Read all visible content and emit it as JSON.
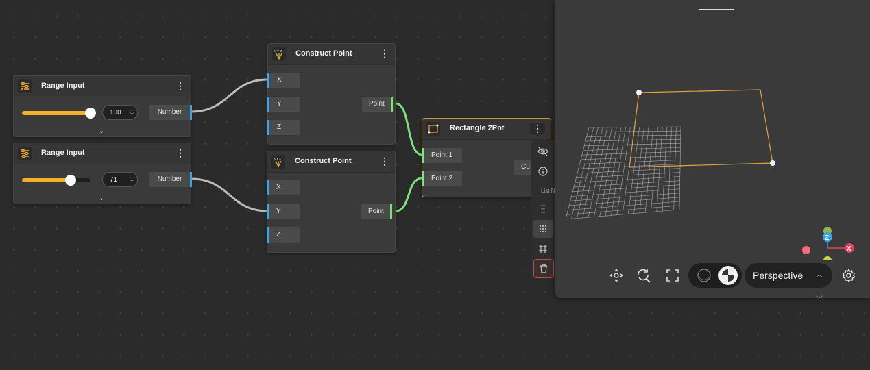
{
  "nodes": {
    "range1": {
      "title": "Range Input",
      "value": "100",
      "output": "Number",
      "slider_fraction": 1.0
    },
    "range2": {
      "title": "Range Input",
      "value": "71",
      "output": "Number",
      "slider_fraction": 0.71
    },
    "construct1": {
      "title": "Construct Point",
      "inputs": [
        "X",
        "Y",
        "Z"
      ],
      "output": "Point"
    },
    "construct2": {
      "title": "Construct Point",
      "inputs": [
        "X",
        "Y",
        "Z"
      ],
      "output": "Point"
    },
    "rect": {
      "title": "Rectangle 2Pnt",
      "inputs": [
        "Point 1",
        "Point 2"
      ],
      "output_partial": "Cu"
    }
  },
  "context_menu": {
    "items": [
      "eye-off-icon",
      "info-icon",
      "list-dots-icon",
      "grid-dots-icon",
      "grid-hash-icon",
      "trash-icon"
    ],
    "label_partial": "List N"
  },
  "viewport": {
    "view_mode": "Perspective",
    "axis_labels": {
      "z": "Z",
      "x": "X"
    }
  },
  "colors": {
    "accent": "#f3b12c",
    "wire_number": "#bdbdbd",
    "wire_point": "#7be37b",
    "port_number": "#3aa6e8",
    "selection": "#c79a4a",
    "rectangle_preview": "#e6a23c"
  }
}
